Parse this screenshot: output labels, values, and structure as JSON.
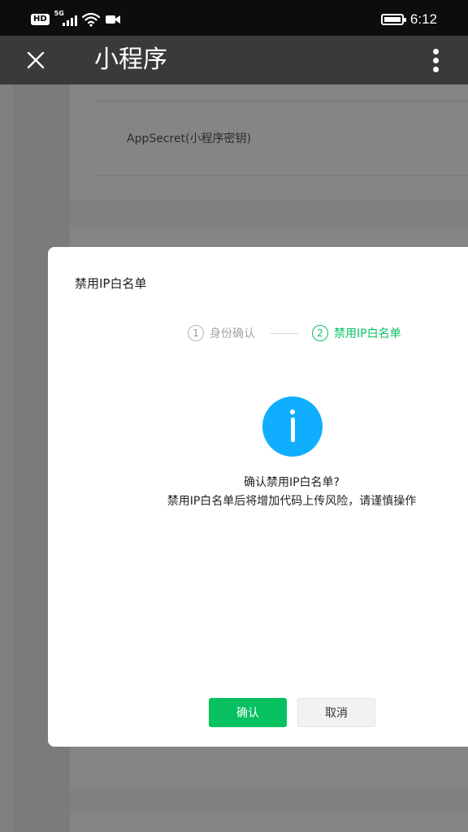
{
  "status_bar": {
    "network_badge": "HD",
    "network_type": "5G",
    "time": "6:12",
    "icons": [
      "hd-icon",
      "signal-icon",
      "wifi-icon",
      "video-camera-icon",
      "battery-icon"
    ]
  },
  "title_bar": {
    "title": "小程序",
    "close_icon": "close-icon",
    "more_icon": "more-vertical-icon"
  },
  "background": {
    "field_label": "AppSecret(小程序密钥)"
  },
  "modal": {
    "title": "禁用IP白名单",
    "steps": [
      {
        "number": "1",
        "label": "身份确认",
        "active": false
      },
      {
        "number": "2",
        "label": "禁用IP白名单",
        "active": true
      }
    ],
    "icon": "info-icon",
    "message_title": "确认禁用IP白名单?",
    "message_desc": "禁用IP白名单后将增加代码上传风险，请谨慎操作",
    "confirm_label": "确认",
    "cancel_label": "取消"
  },
  "colors": {
    "accent_green": "#07c160",
    "info_blue": "#10aeff",
    "title_bar_bg": "#3a3a3a"
  }
}
